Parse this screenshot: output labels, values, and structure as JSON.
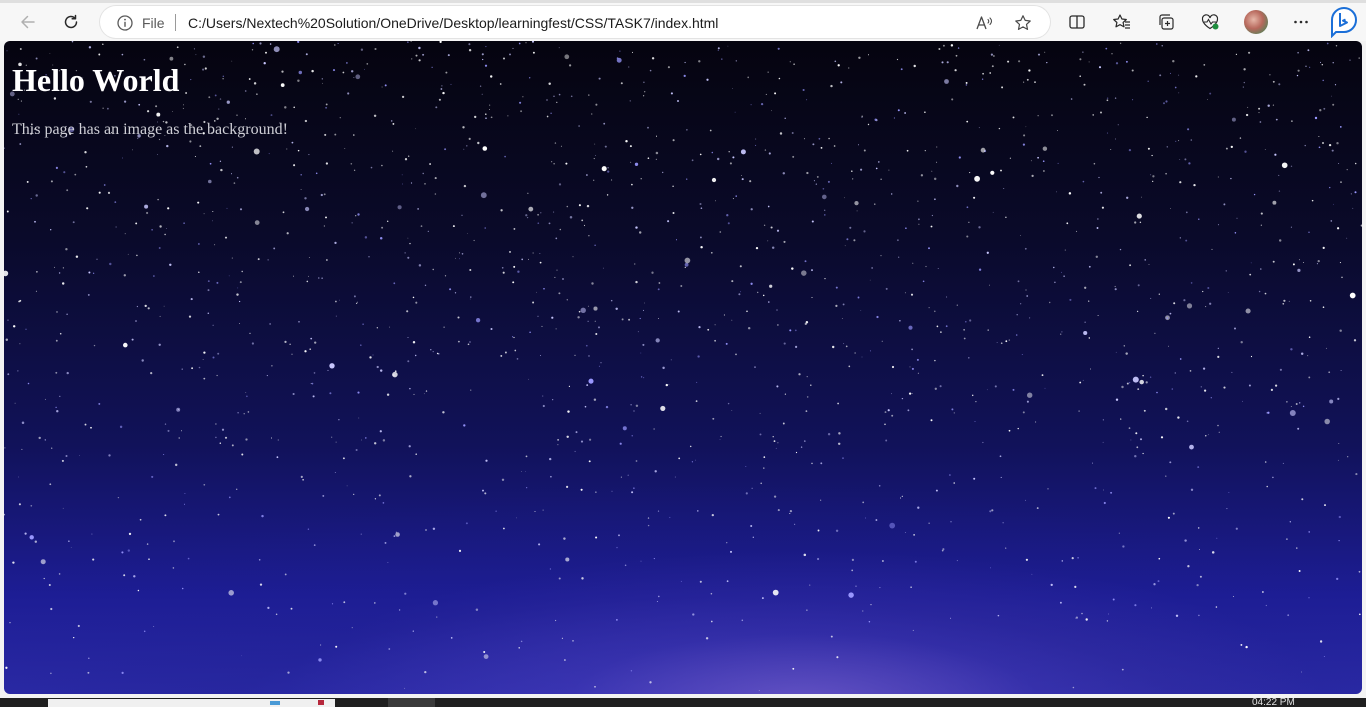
{
  "browser": {
    "address_bar": {
      "scheme_label": "File",
      "url": "C:/Users/Nextech%20Solution/OneDrive/Desktop/learningfest/CSS/TASK7/index.html"
    },
    "icons": {
      "back": "back-arrow-icon",
      "refresh": "refresh-icon",
      "site_info": "info-icon",
      "read_aloud": "read-aloud-icon",
      "favorite": "star-icon",
      "split_screen": "split-screen-icon",
      "favorites": "favorites-icon",
      "collections": "collections-icon",
      "browser_essentials": "heart-pulse-icon",
      "profile": "avatar",
      "menu": "more-icon",
      "copilot": "bing-copilot-icon"
    }
  },
  "page": {
    "heading": "Hello World",
    "paragraph": "This page has an image as the background!"
  },
  "taskbar": {
    "clock_partial": "04:22 PM"
  },
  "colors": {
    "sky_top": "#05040f",
    "sky_bottom": "#2b2aa6",
    "heading_text": "#ffffff",
    "paragraph_text": "#cfcfd6",
    "copilot_accent": "#1b6fd8"
  }
}
